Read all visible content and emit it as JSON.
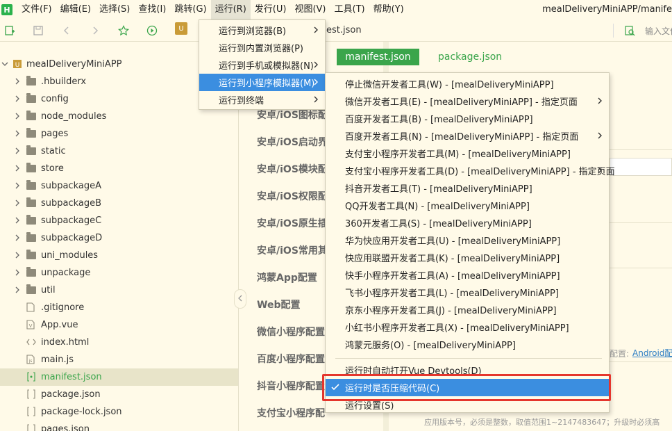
{
  "app": {
    "logo_letter": "H",
    "window_title": "mealDeliveryMiniAPP/manife"
  },
  "menubar": [
    {
      "label": "文件(F)"
    },
    {
      "label": "编辑(E)"
    },
    {
      "label": "选择(S)"
    },
    {
      "label": "查找(I)"
    },
    {
      "label": "跳转(G)"
    },
    {
      "label": "运行(R)"
    },
    {
      "label": "发行(U)"
    },
    {
      "label": "视图(V)"
    },
    {
      "label": "工具(T)"
    },
    {
      "label": "帮助(Y)"
    }
  ],
  "toolbar": {
    "tab_fragment": "est.json",
    "search_placeholder": "输入文件"
  },
  "file_tree": [
    {
      "label": "mealDeliveryMiniAPP",
      "kind": "project",
      "expanded": true
    },
    {
      "label": ".hbuilderx",
      "kind": "folder"
    },
    {
      "label": "config",
      "kind": "folder"
    },
    {
      "label": "node_modules",
      "kind": "folder"
    },
    {
      "label": "pages",
      "kind": "folder"
    },
    {
      "label": "static",
      "kind": "folder"
    },
    {
      "label": "store",
      "kind": "folder"
    },
    {
      "label": "subpackageA",
      "kind": "folder"
    },
    {
      "label": "subpackageB",
      "kind": "folder"
    },
    {
      "label": "subpackageC",
      "kind": "folder"
    },
    {
      "label": "subpackageD",
      "kind": "folder"
    },
    {
      "label": "uni_modules",
      "kind": "folder"
    },
    {
      "label": "unpackage",
      "kind": "folder"
    },
    {
      "label": "util",
      "kind": "folder"
    },
    {
      "label": ".gitignore",
      "kind": "file"
    },
    {
      "label": "App.vue",
      "kind": "vue"
    },
    {
      "label": "index.html",
      "kind": "html"
    },
    {
      "label": "main.js",
      "kind": "js"
    },
    {
      "label": "manifest.json",
      "kind": "json",
      "selected": true
    },
    {
      "label": "package.json",
      "kind": "json"
    },
    {
      "label": "package-lock.json",
      "kind": "json"
    },
    {
      "label": "pages.json",
      "kind": "json"
    }
  ],
  "settings_nav": [
    {
      "label": "安卓/iOS图标配"
    },
    {
      "label": "安卓/iOS启动界"
    },
    {
      "label": "安卓/iOS模块配"
    },
    {
      "label": "安卓/iOS权限配"
    },
    {
      "label": "安卓/iOS原生插"
    },
    {
      "label": "安卓/iOS常用其"
    },
    {
      "label": "鸿蒙App配置"
    },
    {
      "label": "Web配置"
    },
    {
      "label": "微信小程序配置"
    },
    {
      "label": "百度小程序配置"
    },
    {
      "label": "抖音小程序配置"
    },
    {
      "label": "支付宝小程序配"
    }
  ],
  "editor_tabs": {
    "manifest": "manifest.json",
    "package": "package.json"
  },
  "right_panel": {
    "config_hint": "配置:",
    "android_link": "Android配",
    "version_hint": "应用版本号，必须是整数，取值范围1~2147483647；升级时必须高"
  },
  "run_menu": [
    {
      "label": "运行到浏览器(B)",
      "submenu": true
    },
    {
      "label": "运行到内置浏览器(P)",
      "submenu": false
    },
    {
      "label": "运行到手机或模拟器(N)",
      "submenu": true
    },
    {
      "label": "运行到小程序模拟器(M)",
      "submenu": true,
      "highlighted": true
    },
    {
      "label": "运行到终端",
      "submenu": true
    }
  ],
  "miniprogram_submenu": [
    {
      "label": "停止微信开发者工具(W) - [mealDeliveryMiniAPP]",
      "submenu": false
    },
    {
      "label": "微信开发者工具(E) - [mealDeliveryMiniAPP] - 指定页面",
      "submenu": true
    },
    {
      "label": "百度开发者工具(B) - [mealDeliveryMiniAPP]",
      "submenu": false
    },
    {
      "label": "百度开发者工具(N) - [mealDeliveryMiniAPP] - 指定页面",
      "submenu": true
    },
    {
      "label": "支付宝小程序开发者工具(M) - [mealDeliveryMiniAPP]",
      "submenu": false
    },
    {
      "label": "支付宝小程序开发者工具(D) - [mealDeliveryMiniAPP] - 指定页面",
      "submenu": true
    },
    {
      "label": "抖音开发者工具(T) - [mealDeliveryMiniAPP]",
      "submenu": false
    },
    {
      "label": "QQ开发者工具(N) - [mealDeliveryMiniAPP]",
      "submenu": false
    },
    {
      "label": "360开发者工具(S) - [mealDeliveryMiniAPP]",
      "submenu": false
    },
    {
      "label": "华为快应用开发者工具(U) - [mealDeliveryMiniAPP]",
      "submenu": false
    },
    {
      "label": "快应用联盟开发者工具(K) - [mealDeliveryMiniAPP]",
      "submenu": false
    },
    {
      "label": "快手小程序开发者工具(A) - [mealDeliveryMiniAPP]",
      "submenu": false
    },
    {
      "label": "飞书小程序开发者工具(L) - [mealDeliveryMiniAPP]",
      "submenu": false
    },
    {
      "label": "京东小程序开发者工具(J) - [mealDeliveryMiniAPP]",
      "submenu": false
    },
    {
      "label": "小红书小程序开发者工具(X) - [mealDeliveryMiniAPP]",
      "submenu": false
    },
    {
      "label": "鸿蒙元服务(O) - [mealDeliveryMiniAPP]",
      "submenu": false
    }
  ],
  "submenu_options": [
    {
      "label": "运行时自动打开Vue Devtools(D)",
      "checked": false
    },
    {
      "label": "运行时是否压缩代码(C)",
      "checked": true,
      "highlighted": true
    },
    {
      "label": "运行设置(S)",
      "checked": false
    }
  ],
  "colors": {
    "background": "#fffae8",
    "accent_green": "#3aa54b",
    "menu_highlight": "#3b8ee0",
    "annotation_red": "#e5362d"
  }
}
